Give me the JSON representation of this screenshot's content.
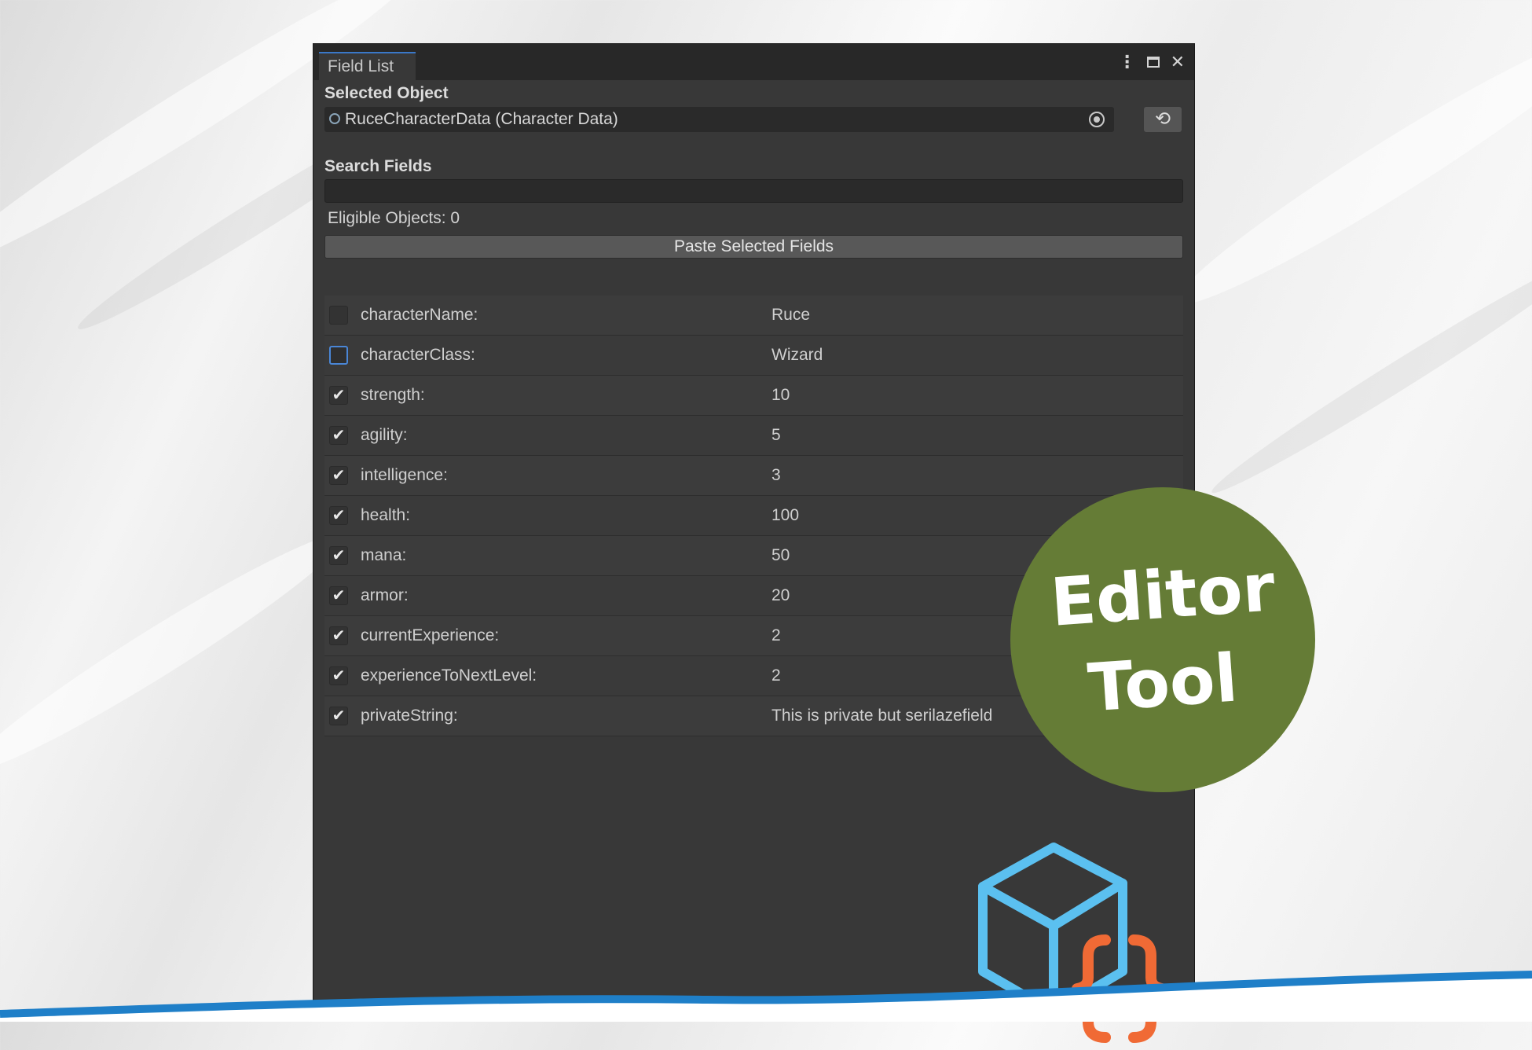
{
  "window": {
    "tab_title": "Field List",
    "controls": [
      "more-icon",
      "maximize-icon",
      "close-icon"
    ]
  },
  "selected_object": {
    "label": "Selected Object",
    "value": "RuceCharacterData (Character Data)"
  },
  "search": {
    "label": "Search Fields",
    "value": ""
  },
  "eligible_text": "Eligible Objects: 0",
  "paste_button_label": "Paste Selected Fields",
  "fields": [
    {
      "name": "characterName:",
      "value": "Ruce",
      "checked": false
    },
    {
      "name": "characterClass:",
      "value": "Wizard",
      "checked": false,
      "focused": true
    },
    {
      "name": "strength:",
      "value": "10",
      "checked": true
    },
    {
      "name": "agility:",
      "value": "5",
      "checked": true
    },
    {
      "name": "intelligence:",
      "value": "3",
      "checked": true
    },
    {
      "name": "health:",
      "value": "100",
      "checked": true
    },
    {
      "name": "mana:",
      "value": "50",
      "checked": true
    },
    {
      "name": "armor:",
      "value": "20",
      "checked": true
    },
    {
      "name": "currentExperience:",
      "value": "2",
      "checked": true
    },
    {
      "name": "experienceToNextLevel:",
      "value": "2",
      "checked": true
    },
    {
      "name": "privateString:",
      "value": "This is private but serilazefield",
      "checked": true
    }
  ],
  "badge": {
    "line1": "Editor",
    "line2": "Tool"
  },
  "colors": {
    "badge": "#657c36",
    "cube": "#5bc0f0",
    "braces": "#f06a35",
    "wave": "#1f7fc8",
    "tab_accent": "#3a78c8"
  }
}
